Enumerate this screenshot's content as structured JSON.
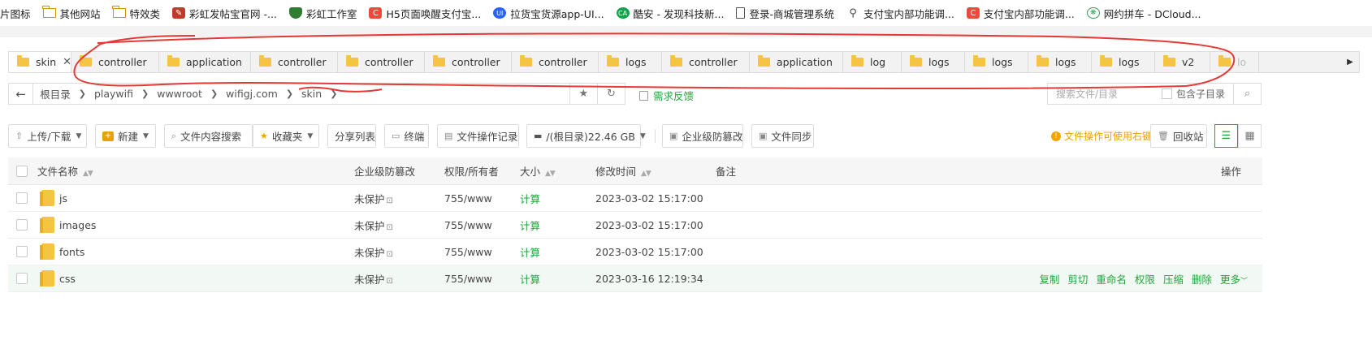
{
  "bookmarks": [
    {
      "label": "片图标",
      "icon": "folder-icon"
    },
    {
      "label": "其他网站",
      "icon": "folder-icon"
    },
    {
      "label": "特效类",
      "icon": "folder-icon"
    },
    {
      "label": "彩虹发帖宝官网 -...",
      "icon": "rainbow-site-icon"
    },
    {
      "label": "彩虹工作室",
      "icon": "shield-icon"
    },
    {
      "label": "H5页面唤醒支付宝...",
      "icon": "c-site-icon"
    },
    {
      "label": "拉货宝货源app-UI...",
      "icon": "ui-site-icon"
    },
    {
      "label": "酷安 - 发现科技新...",
      "icon": "coolapk-icon"
    },
    {
      "label": "登录-商城管理系统",
      "icon": "document-icon"
    },
    {
      "label": "支付宝内部功能调...",
      "icon": "link-icon"
    },
    {
      "label": "支付宝内部功能调...",
      "icon": "c-site-icon"
    },
    {
      "label": "网约拼车 - DCloud...",
      "icon": "dcloud-icon"
    }
  ],
  "tabs": [
    {
      "label": "skin",
      "active": true,
      "closable": true
    },
    {
      "label": "controller"
    },
    {
      "label": "application"
    },
    {
      "label": "controller"
    },
    {
      "label": "controller"
    },
    {
      "label": "controller"
    },
    {
      "label": "controller"
    },
    {
      "label": "logs"
    },
    {
      "label": "controller"
    },
    {
      "label": "application"
    },
    {
      "label": "log"
    },
    {
      "label": "logs"
    },
    {
      "label": "logs"
    },
    {
      "label": "logs"
    },
    {
      "label": "logs"
    },
    {
      "label": "v2"
    },
    {
      "label": "lo"
    }
  ],
  "path": {
    "crumbs": [
      "根目录",
      "playwifi",
      "wwwroot",
      "wifigj.com",
      "skin"
    ]
  },
  "feedback_label": "需求反馈",
  "search": {
    "placeholder": "搜索文件/目录",
    "include_sub_label": "包含子目录"
  },
  "toolbar": {
    "upload_label": "上传/下载",
    "new_label": "新建",
    "content_search_label": "文件内容搜索",
    "favorites_label": "收藏夹",
    "share_list_label": "分享列表",
    "terminal_label": "终端",
    "op_log_label": "文件操作记录",
    "disk_label": "/(根目录)22.46 GB",
    "tamper_label": "企业级防篡改",
    "sync_label": "文件同步",
    "tip_label": "文件操作可使用右键",
    "recycle_label": "回收站"
  },
  "table": {
    "headers": {
      "name": "文件名称",
      "protect": "企业级防篡改",
      "perm": "权限/所有者",
      "size": "大小",
      "mtime": "修改时间",
      "note": "备注",
      "ops": "操作"
    },
    "rows": [
      {
        "name": "js",
        "protect": "未保护",
        "perm": "755/www",
        "size": "计算",
        "mtime": "2023-03-02 15:17:00"
      },
      {
        "name": "images",
        "protect": "未保护",
        "perm": "755/www",
        "size": "计算",
        "mtime": "2023-03-02 15:17:00"
      },
      {
        "name": "fonts",
        "protect": "未保护",
        "perm": "755/www",
        "size": "计算",
        "mtime": "2023-03-02 15:17:00"
      },
      {
        "name": "css",
        "protect": "未保护",
        "perm": "755/www",
        "size": "计算",
        "mtime": "2023-03-16 12:19:34",
        "hovered": true
      }
    ],
    "row_actions": [
      "复制",
      "剪切",
      "重命名",
      "权限",
      "压缩",
      "删除",
      "更多"
    ]
  },
  "colors": {
    "accent": "#20a53a",
    "annotation": "#e53935",
    "folder": "#f6c443",
    "tip": "#e8a200"
  }
}
